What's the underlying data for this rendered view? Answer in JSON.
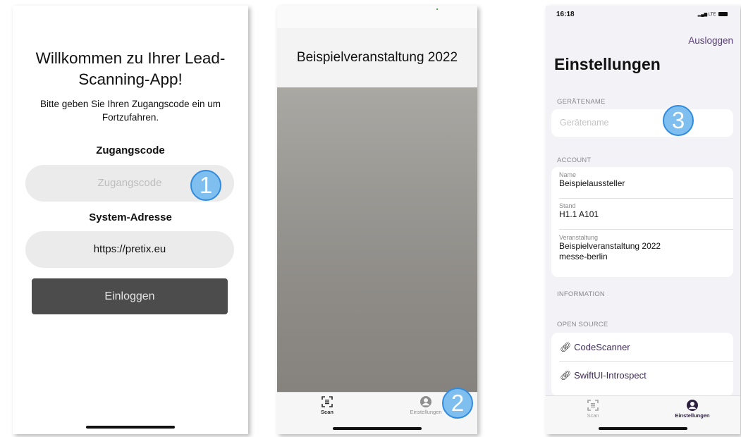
{
  "login": {
    "title_line1": "Willkommen zu Ihrer Lead-",
    "title_line2": "Scanning-App!",
    "subtitle_line1": "Bitte geben Sie Ihren Zugangscode ein um",
    "subtitle_line2": "Fortzufahren.",
    "access_label": "Zugangscode",
    "access_placeholder": "Zugangscode",
    "system_label": "System-Adresse",
    "system_value": "https://pretix.eu",
    "login_button": "Einloggen",
    "badge": "1"
  },
  "scanner": {
    "event_title": "Beispielveranstaltung 2022",
    "tabs": [
      {
        "label": "Scan",
        "icon": "qr-scan-icon"
      },
      {
        "label": "Einstellungen",
        "icon": "person-circle-icon"
      }
    ],
    "badge": "2"
  },
  "settings": {
    "status_time": "16:18",
    "status_network": "LTE",
    "logout": "Ausloggen",
    "title": "Einstellungen",
    "device_section": "GERÄTENAME",
    "device_placeholder": "Gerätename",
    "account_section": "ACCOUNT",
    "account": {
      "name_label": "Name",
      "name_value": "Beispielaussteller",
      "stand_label": "Stand",
      "stand_value": "H1.1 A101",
      "event_label": "Veranstaltung",
      "event_value_line1": "Beispielveranstaltung 2022",
      "event_value_line2": "messe-berlin"
    },
    "info_section": "INFORMATION",
    "opensource_section": "OPEN SOURCE",
    "links": [
      "CodeScanner",
      "SwiftUI-Introspect"
    ],
    "tabs": [
      {
        "label": "Scan",
        "icon": "qr-scan-icon"
      },
      {
        "label": "Einstellungen",
        "icon": "person-circle-icon"
      }
    ],
    "badge": "3"
  },
  "colors": {
    "badge_fill": "#7fbfef",
    "badge_border": "#2f8be0",
    "accent_purple": "#5a3f7a",
    "button_dark": "#4c4c4c"
  }
}
